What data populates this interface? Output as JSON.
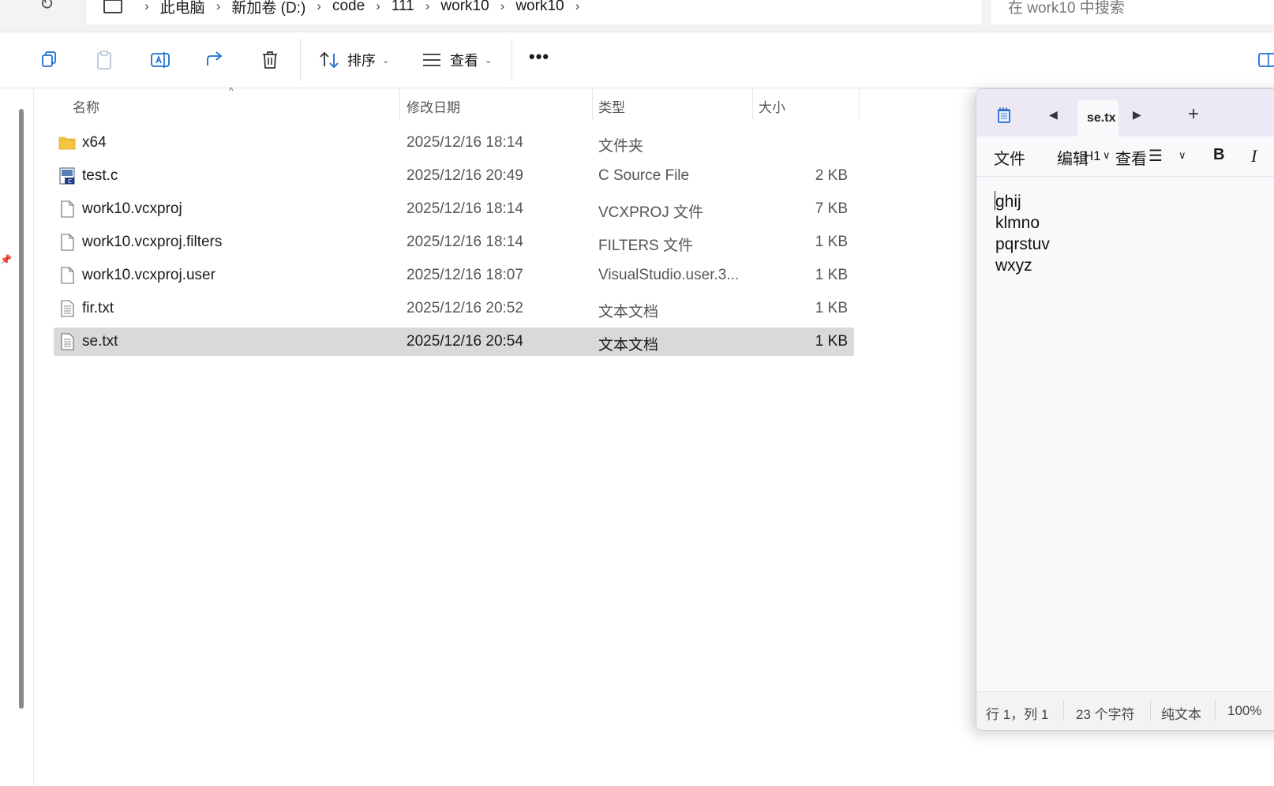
{
  "breadcrumb": {
    "items": [
      "此电脑",
      "新加卷 (D:)",
      "code",
      "111",
      "work10",
      "work10"
    ]
  },
  "search": {
    "placeholder": "在 work10 中搜索"
  },
  "toolbar": {
    "sort_label": "排序",
    "view_label": "查看",
    "more_label": "•••"
  },
  "columns": {
    "name": "名称",
    "modified": "修改日期",
    "type": "类型",
    "size": "大小"
  },
  "files": [
    {
      "name": "x64",
      "modified": "2025/12/16 18:14",
      "type": "文件夹",
      "size": "",
      "icon": "folder-icon"
    },
    {
      "name": "test.c",
      "modified": "2025/12/16 20:49",
      "type": "C Source File",
      "size": "2 KB",
      "icon": "c-source-file-icon"
    },
    {
      "name": "work10.vcxproj",
      "modified": "2025/12/16 18:14",
      "type": "VCXPROJ 文件",
      "size": "7 KB",
      "icon": "file-icon"
    },
    {
      "name": "work10.vcxproj.filters",
      "modified": "2025/12/16 18:14",
      "type": "FILTERS 文件",
      "size": "1 KB",
      "icon": "file-icon"
    },
    {
      "name": "work10.vcxproj.user",
      "modified": "2025/12/16 18:07",
      "type": "VisualStudio.user.3...",
      "size": "1 KB",
      "icon": "file-icon"
    },
    {
      "name": "fir.txt",
      "modified": "2025/12/16 20:52",
      "type": "文本文档",
      "size": "1 KB",
      "icon": "text-file-icon"
    },
    {
      "name": "se.txt",
      "modified": "2025/12/16 20:54",
      "type": "文本文档",
      "size": "1 KB",
      "icon": "text-file-icon",
      "selected": true
    }
  ],
  "notepad": {
    "tab_title": "se.tx",
    "menu": {
      "file": "文件",
      "edit": "编辑",
      "view": "查看",
      "heading_glyph": "H1",
      "list_glyph": "☰",
      "bold": "B",
      "italic": "I"
    },
    "lines": [
      "ghij",
      "klmno",
      "pqrstuv",
      "wxyz"
    ],
    "status": {
      "position": "行 1，列 1",
      "chars": "23 个字符",
      "format": "纯文本",
      "zoom": "100%"
    }
  },
  "colors": {
    "selected_row": "#d9d9d9",
    "notepad_titlebar": "#ece9f5",
    "folder": "#f5c542"
  }
}
